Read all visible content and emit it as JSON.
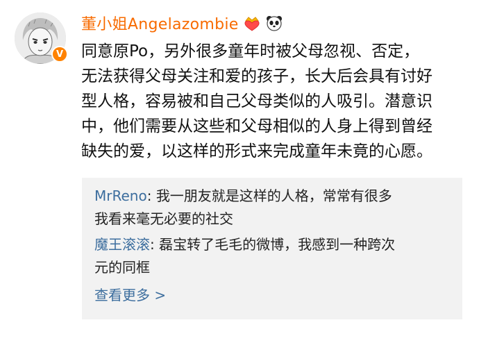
{
  "post": {
    "author": "董小姐Angelazombie",
    "badges": [
      "crown-heart-icon",
      "panda-icon"
    ],
    "verified_badge": "V",
    "content_lines": [
      "同意原Po，另外很多童年时被父母忽视、否定，",
      "无法获得父母关注和爱的孩子，长大后会具有讨好",
      "型人格，容易被和自己父母类似的人吸引。潜意识",
      "中，他们需要从这些和父母相似的人身上得到曾经",
      "缺失的爱，以这样的形式来完成童年未竟的心愿。"
    ]
  },
  "replies": [
    {
      "user": "MrReno",
      "sep": ": ",
      "line1": "我一朋友就是这样的人格，常常有很多",
      "line2": "我看来毫无必要的社交"
    },
    {
      "user": "魔王滚滚",
      "sep": ": ",
      "line1": "磊宝转了毛毛的微博，我感到一种跨次",
      "line2": "元的同框"
    }
  ],
  "view_more": "查看更多 >",
  "colors": {
    "username": "#f86b00",
    "reply_user": "#3d6e9e",
    "reply_bg": "#f2f2f2",
    "verified": "#ff8200"
  }
}
